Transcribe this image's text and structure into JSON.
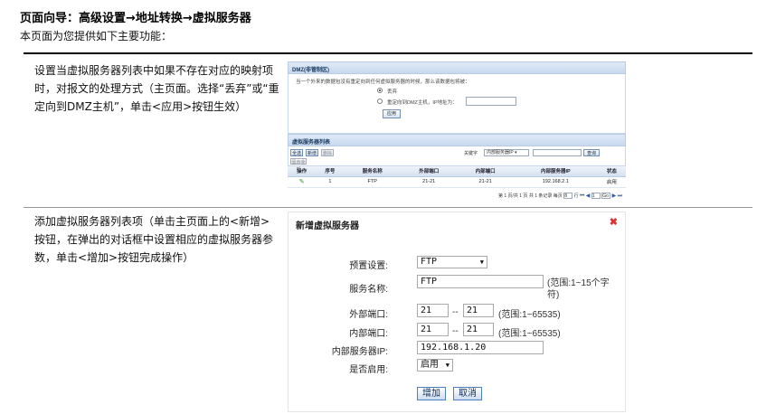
{
  "header": {
    "title": "页面向导：高级设置→地址转换→虚拟服务器",
    "subtitle": "本页面为您提供如下主要功能："
  },
  "rows": [
    {
      "description": "设置当虚拟服务器列表中如果不存在对应的映射项时，对报文的处理方式（主页面。选择“丢弃”或“重定向到DMZ主机”，单击<应用>按钮生效）"
    },
    {
      "description": "添加虚拟服务器列表项（单击主页面上的<新增>按钮，在弹出的对话框中设置相应的虚拟服务器参数，单击<增加>按钮完成操作）"
    }
  ],
  "shot1": {
    "dmz_title": "DMZ(非管制区)",
    "dmz_desc": "当一个外来的数据包没有重定向到任何虚拟服务器的时候，那么该数据包将被：",
    "opt_drop": "丢弃",
    "opt_redirect": "重定向到DMZ主机，IP地址为：",
    "apply": "应用",
    "list_title": "虚拟服务器列表",
    "btn_all": "全选",
    "btn_new": "新增",
    "btn_delete": "删除",
    "btn_show_all": "显示全部",
    "keyword_label": "关键字",
    "keyword_value": "内部服务器IP",
    "search": "查询",
    "columns": [
      "操作",
      "序号",
      "服务名称",
      "外部端口",
      "内部端口",
      "内部服务器IP",
      "状态"
    ],
    "rows": [
      {
        "index": "1",
        "name": "FTP",
        "ext": "21-21",
        "int": "21-21",
        "ip": "192.168.2.1",
        "status": "启用"
      }
    ],
    "pager_text": "第 1 页/共 1 页 共 1 条记录 每页",
    "pager_size": "8",
    "pager_goto": "行",
    "pager_page": "1",
    "pager_go": "Go"
  },
  "shot2": {
    "title": "新增虚拟服务器",
    "preset_label": "预置设置:",
    "preset_value": "FTP",
    "name_label": "服务名称:",
    "name_value": "FTP",
    "name_hint": "(范围:1~15个字符)",
    "ext_label": "外部端口:",
    "ext_from": "21",
    "ext_to": "21",
    "ext_hint": "(范围:1~65535)",
    "int_label": "内部端口:",
    "int_from": "21",
    "int_to": "21",
    "int_hint": "(范围:1~65535)",
    "ip_label": "内部服务器IP:",
    "ip_value": "192.168.1.20",
    "enable_label": "是否启用:",
    "enable_value": "启用",
    "dash": "--",
    "add_btn": "增加",
    "cancel_btn": "取消"
  },
  "icons": {
    "edit": "pencil-icon",
    "close": "close-icon",
    "dropdown": "caret-down-icon"
  }
}
